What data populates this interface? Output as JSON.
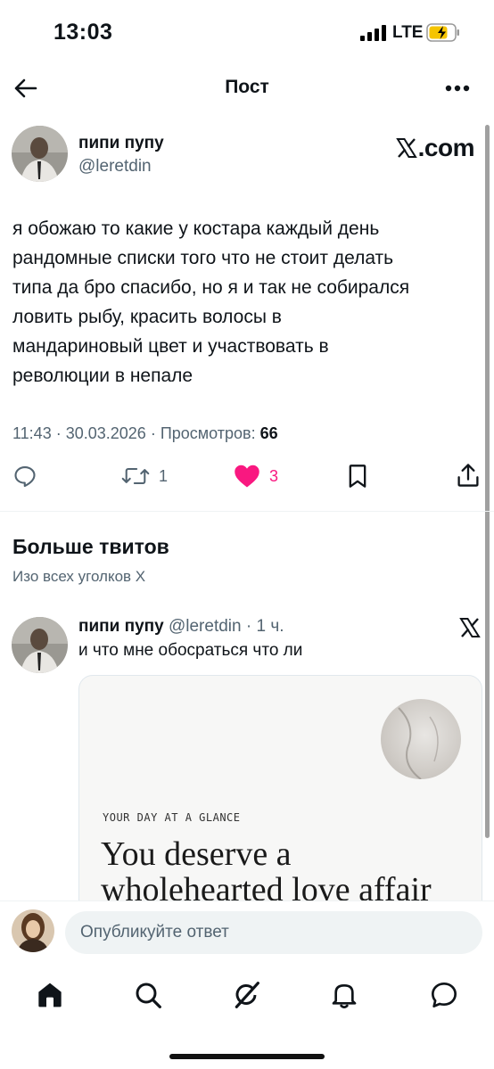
{
  "status_bar": {
    "time": "13:03",
    "network": "LTE",
    "battery_charging": true
  },
  "header": {
    "title": "Пост"
  },
  "post": {
    "author_name": "пипи пупу",
    "handle": "@leretdin",
    "source_logo": ".com",
    "text": "я обожаю то какие у костара каждый день\nрандомные списки того что не  стоит делать\nтипа да бро спасибо, но я и так не собирался\nловить рыбу, красить волосы в\nмандариновый цвет и участвовать в\nреволюции в непале",
    "time": "11:43",
    "date": "30.03.2026",
    "views_label": "Просмотров:",
    "views": "66",
    "reposts": "1",
    "likes": "3",
    "liked": true,
    "like_color": "#f91880"
  },
  "more": {
    "title": "Больше твитов",
    "subtitle": "Изо всех уголков X"
  },
  "related": {
    "author_name": "пипи пупу",
    "handle": "@leretdin",
    "separator": "·",
    "time": "1 ч.",
    "text": "и что мне обосраться что ли",
    "card": {
      "kicker": "YOUR DAY AT A GLANCE",
      "title": "You deserve a\nwholehearted love affair"
    }
  },
  "reply": {
    "placeholder": "Опубликуйте ответ"
  },
  "tabs": [
    {
      "icon": "home-icon",
      "active": true
    },
    {
      "icon": "search-icon"
    },
    {
      "icon": "grok-icon"
    },
    {
      "icon": "bell-icon"
    },
    {
      "icon": "messages-icon"
    }
  ]
}
